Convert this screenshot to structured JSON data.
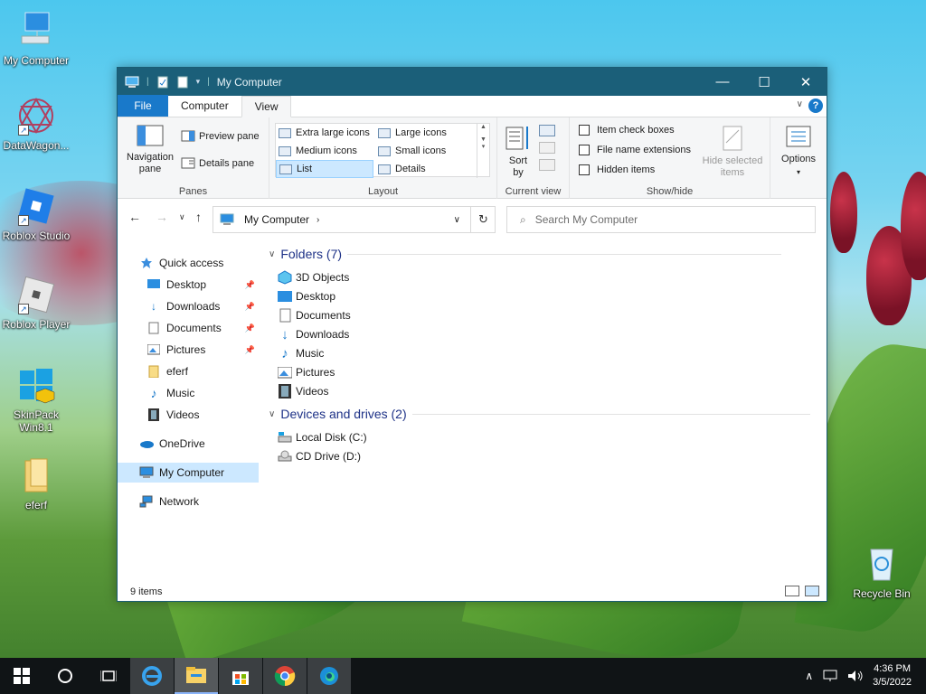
{
  "desktop": {
    "icons": [
      {
        "label": "My Computer",
        "icon": "computer-icon"
      },
      {
        "label": "DataWagon...",
        "icon": "datawagon-icon"
      },
      {
        "label": "Roblox Studio",
        "icon": "roblox-studio-icon"
      },
      {
        "label": "Roblox Player",
        "icon": "roblox-player-icon"
      },
      {
        "label": "SkinPack Win8.1",
        "icon": "skinpack-icon"
      },
      {
        "label": "eferf",
        "icon": "folder-icon"
      }
    ],
    "recycle_bin": "Recycle Bin"
  },
  "window": {
    "title": "My Computer",
    "controls": {
      "minimize": "—",
      "maximize": "☐",
      "close": "✕"
    },
    "tabs": {
      "file": "File",
      "computer": "Computer",
      "view": "View"
    },
    "help": "?"
  },
  "ribbon": {
    "panes": {
      "navigation_pane": "Navigation pane",
      "preview_pane": "Preview pane",
      "details_pane": "Details pane",
      "label": "Panes"
    },
    "layout": {
      "items": [
        "Extra large icons",
        "Large icons",
        "Medium icons",
        "Small icons",
        "List",
        "Details"
      ],
      "selected": "List",
      "label": "Layout"
    },
    "current_view": {
      "sort_by": "Sort by",
      "label": "Current view"
    },
    "show_hide": {
      "item_check_boxes": "Item check boxes",
      "file_name_extensions": "File name extensions",
      "hidden_items": "Hidden items",
      "hide_selected_items": "Hide selected items",
      "label": "Show/hide"
    },
    "options": "Options"
  },
  "address": {
    "path": "My Computer",
    "search_placeholder": "Search My Computer"
  },
  "nav": {
    "quick_access": "Quick access",
    "quick_items": [
      {
        "label": "Desktop",
        "pinned": true
      },
      {
        "label": "Downloads",
        "pinned": true
      },
      {
        "label": "Documents",
        "pinned": true
      },
      {
        "label": "Pictures",
        "pinned": true
      },
      {
        "label": "eferf",
        "pinned": false
      },
      {
        "label": "Music",
        "pinned": false
      },
      {
        "label": "Videos",
        "pinned": false
      }
    ],
    "onedrive": "OneDrive",
    "my_computer": "My Computer",
    "network": "Network"
  },
  "content": {
    "folders_header": "Folders (7)",
    "folders": [
      "3D Objects",
      "Desktop",
      "Documents",
      "Downloads",
      "Music",
      "Pictures",
      "Videos"
    ],
    "devices_header": "Devices and drives (2)",
    "devices": [
      "Local Disk (C:)",
      "CD Drive (D:)"
    ]
  },
  "status": {
    "items": "9 items"
  },
  "taskbar": {
    "apps": [
      "Internet Explorer",
      "File Explorer",
      "Microsoft Store",
      "Google Chrome",
      "Microsoft Edge"
    ],
    "time": "4:36 PM",
    "date": "3/5/2022"
  },
  "colors": {
    "titlebar": "#1b5f79",
    "accent": "#1979ca",
    "selection": "#cce8ff",
    "taskbar": "#101416"
  }
}
